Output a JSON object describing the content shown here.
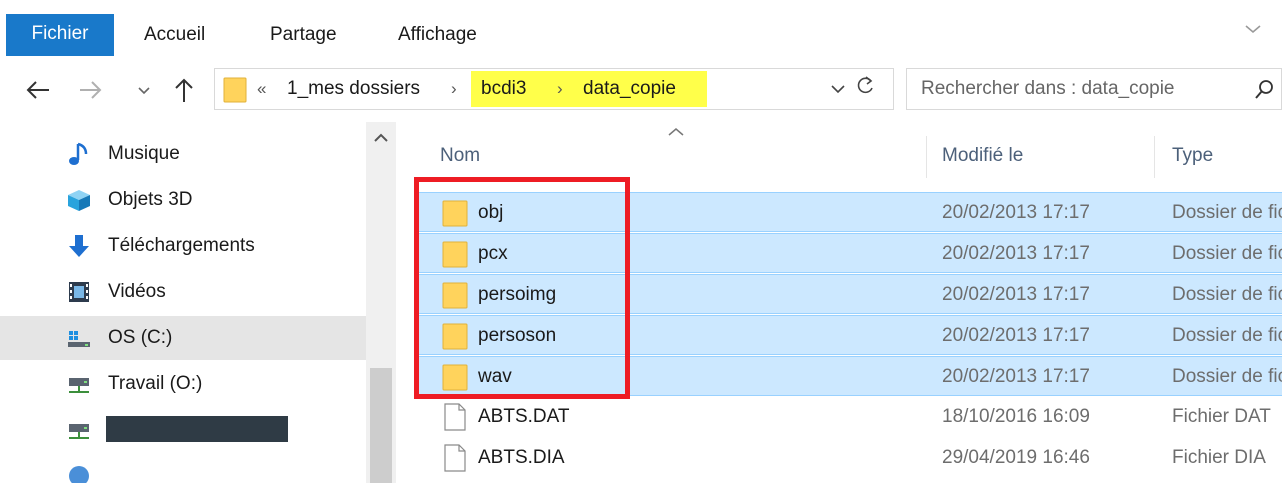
{
  "ribbon": {
    "tabs": [
      "Fichier",
      "Accueil",
      "Partage",
      "Affichage"
    ],
    "expand_icon": "chevron-down-icon"
  },
  "address": {
    "crumbs": [
      "1_mes dossiers",
      "bcdi3",
      "data_copie"
    ],
    "overflow": "«",
    "highlighted": [
      "bcdi3",
      "data_copie"
    ]
  },
  "search": {
    "placeholder": "Rechercher dans : data_copie"
  },
  "nav_pane": {
    "items": [
      {
        "label": "Musique",
        "icon": "music-note-icon"
      },
      {
        "label": "Objets 3D",
        "icon": "cube-3d-icon"
      },
      {
        "label": "Téléchargements",
        "icon": "download-arrow-icon"
      },
      {
        "label": "Vidéos",
        "icon": "film-icon"
      },
      {
        "label": "OS (C:)",
        "icon": "windows-drive-icon",
        "selected": true
      },
      {
        "label": "Travail (O:)",
        "icon": "network-drive-icon"
      },
      {
        "label": "",
        "icon": "network-drive-icon",
        "redacted": true
      }
    ]
  },
  "columns": {
    "name": "Nom",
    "modified": "Modifié le",
    "type": "Type"
  },
  "files": [
    {
      "name": "obj",
      "modified": "20/02/2013 17:17",
      "type": "Dossier de fichiers",
      "kind": "folder",
      "selected": true
    },
    {
      "name": "pcx",
      "modified": "20/02/2013 17:17",
      "type": "Dossier de fichiers",
      "kind": "folder",
      "selected": true
    },
    {
      "name": "persoimg",
      "modified": "20/02/2013 17:17",
      "type": "Dossier de fichiers",
      "kind": "folder",
      "selected": true
    },
    {
      "name": "persoson",
      "modified": "20/02/2013 17:17",
      "type": "Dossier de fichiers",
      "kind": "folder",
      "selected": true
    },
    {
      "name": "wav",
      "modified": "20/02/2013 17:17",
      "type": "Dossier de fichiers",
      "kind": "folder",
      "selected": true
    },
    {
      "name": "ABTS.DAT",
      "modified": "18/10/2016 16:09",
      "type": "Fichier DAT",
      "kind": "file",
      "selected": false
    },
    {
      "name": "ABTS.DIA",
      "modified": "29/04/2019 16:46",
      "type": "Fichier DIA",
      "kind": "file",
      "selected": false
    }
  ],
  "colors": {
    "file_tab": "#1979ca",
    "selection": "#cce8ff",
    "highlight": "#ffff4a",
    "annotation": "#ee1c24"
  }
}
